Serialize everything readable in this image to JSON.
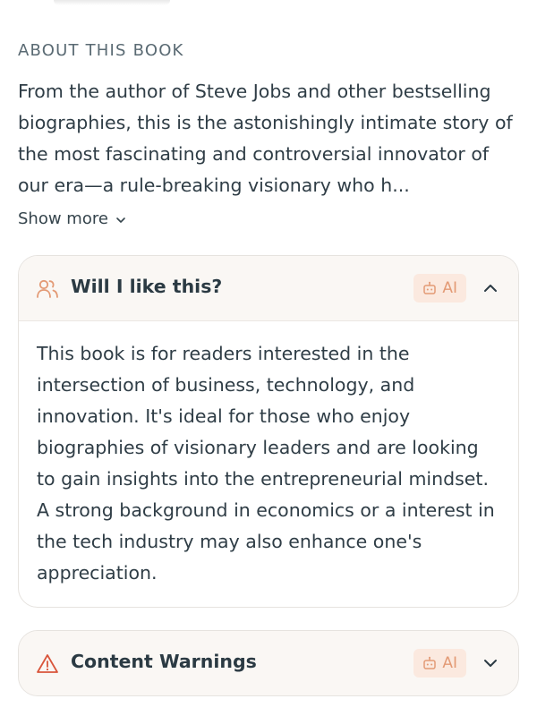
{
  "about": {
    "heading": "ABOUT THIS BOOK",
    "description": "From the author of Steve Jobs and other bestselling biographies, this is the astonishingly intimate story of the most fascinating and controversial innovator of our era—a rule-breaking visionary who h...",
    "show_more_label": "Show more"
  },
  "cards": [
    {
      "title": "Will I like this?",
      "ai_label": "AI",
      "expanded": true,
      "body": "This book is for readers interested in the intersection of business, technology, and innovation. It's ideal for those who enjoy biographies of visionary leaders and are looking to gain insights into the entrepreneurial mindset. A strong background in economics or a interest in the tech industry may also enhance one's appreciation."
    },
    {
      "title": "Content Warnings",
      "ai_label": "AI",
      "expanded": false
    }
  ],
  "colors": {
    "accent": "#e39a75",
    "warning_icon": "#d9553b",
    "card_header_bg": "#faf7f4",
    "ai_badge_bg": "#fbe9df"
  },
  "icons": {
    "card_1": "users-icon",
    "card_2": "warning-triangle-icon",
    "ai": "robot-icon"
  }
}
